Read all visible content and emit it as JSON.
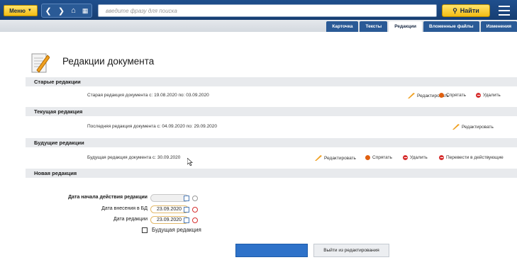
{
  "topbar": {
    "menu_label": "Меню",
    "search_placeholder": "введите фразу для поиска",
    "find_label": "Найти",
    "icons": [
      "chevron-left-icon",
      "chevron-right-icon",
      "home-icon",
      "grid-icon",
      "search-icon",
      "menu-icon"
    ]
  },
  "tabs": [
    {
      "label": "Карточка",
      "active": false
    },
    {
      "label": "Тексты",
      "active": false
    },
    {
      "label": "Редакции",
      "active": true
    },
    {
      "label": "Вложенные файлы",
      "active": false
    },
    {
      "label": "Изменения",
      "active": false
    }
  ],
  "page": {
    "title": "Редакции документа"
  },
  "sections": {
    "old": {
      "heading": "Старые редакции",
      "row_text": "Старая редакция документа с: 19.08.2020 по: 03.09.2020",
      "actions": {
        "edit": "Редактировать",
        "hide": "Спрятать",
        "delete": "Удалить"
      }
    },
    "current": {
      "heading": "Текущая редакция",
      "row_text": "Последняя редакция документа с: 04.09.2020 по: 29.09.2020",
      "actions": {
        "edit": "Редактировать"
      }
    },
    "future": {
      "heading": "Будущие редакции",
      "row_text": "Будущая редакция документа с: 30.09.2020",
      "actions": {
        "edit": "Редактировать",
        "hide": "Спрятать",
        "delete": "Удалить",
        "activate": "Перевести в действующие"
      }
    },
    "new": {
      "heading": "Новая редакция"
    }
  },
  "form": {
    "start_date_label": "Дата начала действия редакции",
    "start_date_value": "",
    "db_date_label": "Дата внесения в БД",
    "db_date_value": "23.09.2020",
    "edition_date_label": "Дата редакции",
    "edition_date_value": "23.09.2020",
    "future_checkbox_label": "Будущая редакция",
    "future_checked": false
  },
  "buttons": {
    "primary_label": "",
    "exit_label": "Выйти из редактирования"
  },
  "colors": {
    "header": "#1f4f8d",
    "accent": "#f3bd14",
    "primary": "#2e72c9"
  }
}
